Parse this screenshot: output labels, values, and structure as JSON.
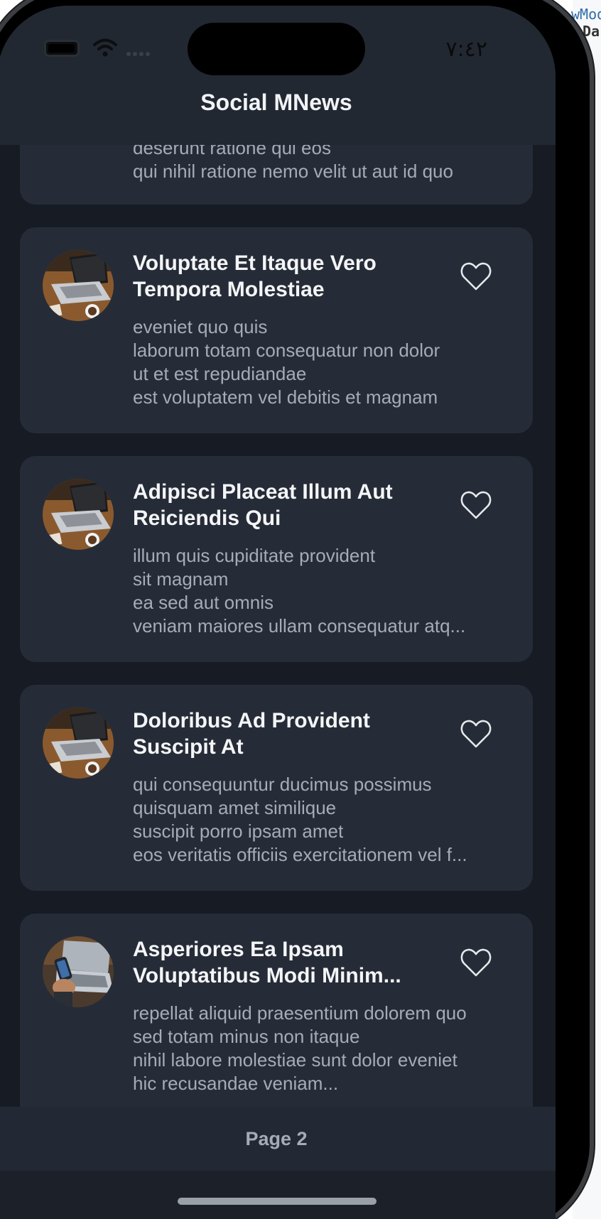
{
  "status_bar": {
    "time": "٧:٤٢"
  },
  "header": {
    "title": "Social MNews"
  },
  "partial_card": {
    "body_lines": [
      "deserunt ratione qui eos",
      "qui nihil ratione nemo velit ut aut id quo"
    ]
  },
  "posts": [
    {
      "title": "Voluptate Et Itaque Vero Tempora Molestiae",
      "body_lines": [
        "eveniet quo quis",
        "laborum totam consequatur non dolor",
        "ut et est repudiandae",
        "est voluptatem vel debitis et magnam"
      ],
      "avatar_icon": "laptop-icon",
      "liked": false
    },
    {
      "title": "Adipisci Placeat Illum Aut Reiciendis Qui",
      "body_lines": [
        "illum quis cupiditate provident",
        "sit magnam",
        "ea sed aut omnis",
        "veniam maiores ullam consequatur atq..."
      ],
      "avatar_icon": "laptop-icon",
      "liked": false
    },
    {
      "title": "Doloribus Ad Provident Suscipit At",
      "body_lines": [
        "qui consequuntur ducimus possimus",
        "quisquam amet similique",
        "suscipit porro ipsam amet",
        "eos veritatis officiis exercitationem vel f..."
      ],
      "avatar_icon": "laptop-icon",
      "liked": false
    },
    {
      "title": "Asperiores Ea Ipsam Voluptatibus Modi Minim...",
      "body_lines": [
        "repellat aliquid praesentium dolorem quo",
        "sed totam minus non itaque",
        "nihil labore molestiae sunt dolor eveniet",
        "hic recusandae veniam..."
      ],
      "avatar_icon": "phone-laptop-icon",
      "liked": false
    }
  ],
  "footer": {
    "page_label": "Page 2"
  },
  "background_editor": {
    "line1": "wMod",
    "line2": "Da"
  },
  "colors": {
    "background": "#161b24",
    "card": "#262c37",
    "title_text": "#f4f5f7",
    "body_text": "#a5acb8"
  }
}
